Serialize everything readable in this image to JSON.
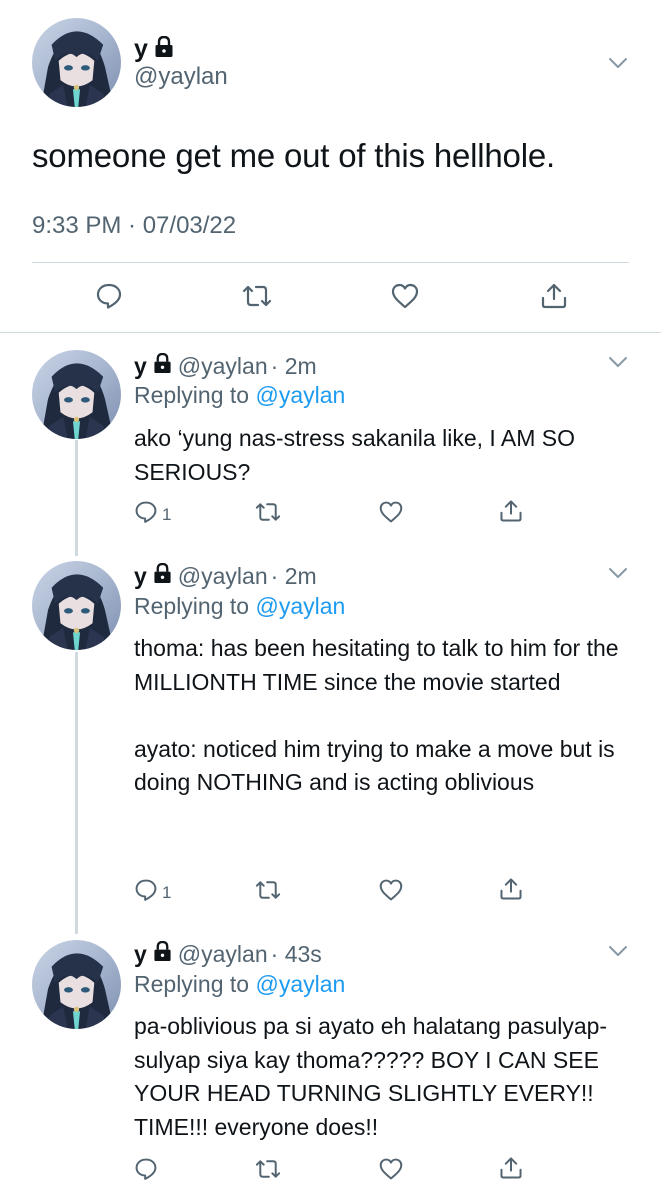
{
  "main_tweet": {
    "display_name": "y",
    "handle": "@yaylan",
    "text": "someone get me out of this hellhole.",
    "timestamp": "9:33 PM · 07/03/22"
  },
  "replies": [
    {
      "display_name": "y",
      "handle": "@yaylan",
      "time": "· 2m",
      "replying_prefix": "Replying to",
      "replying_to": "@yaylan",
      "text": "ako ‘yung nas-stress sakanila like, I AM SO SERIOUS?",
      "reply_count": "1"
    },
    {
      "display_name": "y",
      "handle": "@yaylan",
      "time": "· 2m",
      "replying_prefix": "Replying to",
      "replying_to": "@yaylan",
      "text": "thoma: has been hesitating to talk to him for the MILLIONTH TIME since the movie started\n\nayato: noticed him trying to make a move but is doing NOTHING and is acting oblivious",
      "reply_count": "1"
    },
    {
      "display_name": "y",
      "handle": "@yaylan",
      "time": "· 43s",
      "replying_prefix": "Replying to",
      "replying_to": "@yaylan",
      "text": "pa-oblivious pa si ayato eh halatang pasulyap-sulyap siya kay thoma????? BOY I CAN SEE YOUR HEAD TURNING SLIGHTLY EVERY!! TIME!!! everyone does!!",
      "reply_count": ""
    }
  ],
  "icons": {
    "reply": "reply-bubble-icon",
    "retweet": "retweet-icon",
    "like": "heart-icon",
    "share": "share-icon",
    "protected": "lock-icon",
    "more": "chevron-down-icon"
  },
  "colors": {
    "text": "#0f1419",
    "secondary": "#536471",
    "link": "#1d9bf0",
    "divider": "#cfd9de"
  }
}
